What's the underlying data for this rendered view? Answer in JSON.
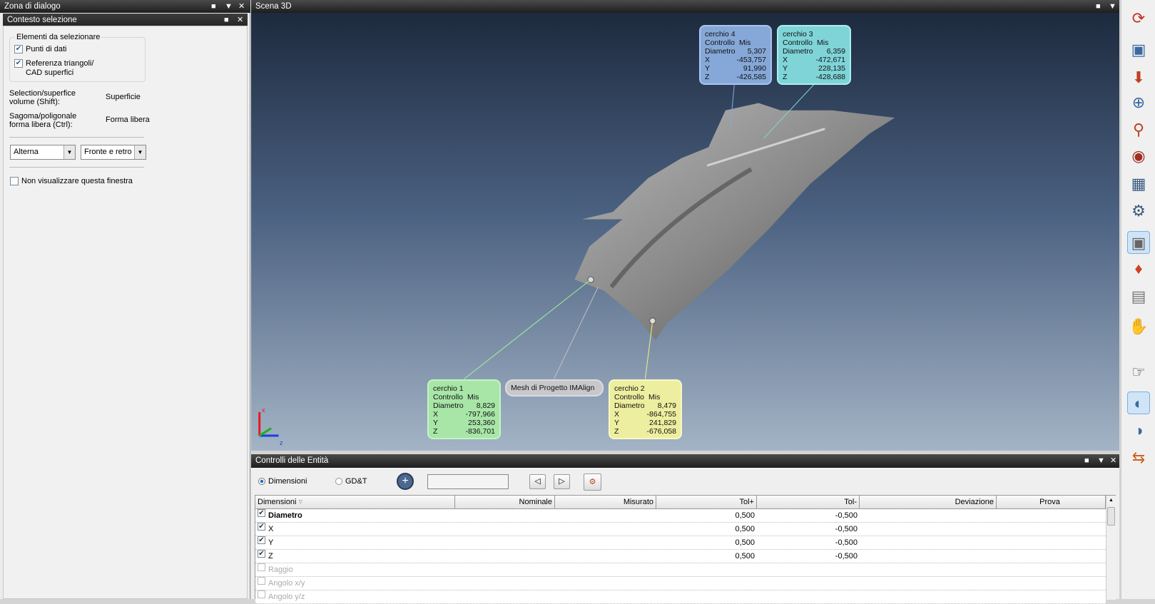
{
  "left_panel": {
    "title": "Zona di dialogo",
    "sub_title": "Contesto selezione",
    "group_title": "Elementi da selezionare",
    "check_points": "Punti di dati",
    "check_points_checked": true,
    "check_ref_1": "Referenza triangoli/",
    "check_ref_2": "CAD superfici",
    "check_ref_checked": true,
    "sel_label_1": "Selection/superfice",
    "sel_label_2": "volume (Shift):",
    "sel_value": "Superficie",
    "shape_label_1": "Sagoma/poligonale",
    "shape_label_2": "forma libera (Ctrl):",
    "shape_value": "Forma libera",
    "combo1": "Alterna",
    "combo2": "Fronte e retro",
    "dont_show": "Non visualizzare questa finestra"
  },
  "scene": {
    "title": "Scena 3D",
    "callouts": [
      {
        "name": "cerchio 4",
        "ctrl": "Controllo",
        "mis": "Mis",
        "diam_label": "Diametro",
        "diam": "5,307",
        "x": "-453,757",
        "y": "91,990",
        "z": "-426,585",
        "color": "#86a8d8"
      },
      {
        "name": "cerchio 3",
        "ctrl": "Controllo",
        "mis": "Mis",
        "diam_label": "Diametro",
        "diam": "6,359",
        "x": "-472,671",
        "y": "228,135",
        "z": "-428,688",
        "color": "#7fd4d8"
      },
      {
        "name": "cerchio 1",
        "ctrl": "Controllo",
        "mis": "Mis",
        "diam_label": "Diametro",
        "diam": "8,829",
        "x": "-797,966",
        "y": "253,360",
        "z": "-836,701",
        "color": "#a8e6a8"
      },
      {
        "name": "cerchio 2",
        "ctrl": "Controllo",
        "mis": "Mis",
        "diam_label": "Diametro",
        "diam": "8,479",
        "x": "-864,755",
        "y": "241,829",
        "z": "-676,058",
        "color": "#eeeea0"
      }
    ],
    "mesh_label": "Mesh di Progetto IMAlign",
    "axis_x": "x",
    "axis_z": "z"
  },
  "bottom": {
    "title": "Controlli delle Entità",
    "radio_dim": "Dimensioni",
    "radio_gdt": "GD&T",
    "search_value": "",
    "columns": [
      "Dimensioni",
      "Nominale",
      "Misurato",
      "Tol+",
      "Tol-",
      "Deviazione",
      "Prova"
    ],
    "rows": [
      {
        "label": "Diametro",
        "checked": true,
        "bold": true,
        "tolp": "0,500",
        "tolm": "-0,500"
      },
      {
        "label": "X",
        "checked": true,
        "tolp": "0,500",
        "tolm": "-0,500"
      },
      {
        "label": "Y",
        "checked": true,
        "tolp": "0,500",
        "tolm": "-0,500"
      },
      {
        "label": "Z",
        "checked": true,
        "tolp": "0,500",
        "tolm": "-0,500"
      },
      {
        "label": "Raggio",
        "checked": false,
        "tolp": "",
        "tolm": ""
      },
      {
        "label": "Angolo x/y",
        "checked": false,
        "tolp": "",
        "tolm": ""
      },
      {
        "label": "Angolo y/z",
        "checked": false,
        "tolp": "",
        "tolm": ""
      }
    ]
  }
}
